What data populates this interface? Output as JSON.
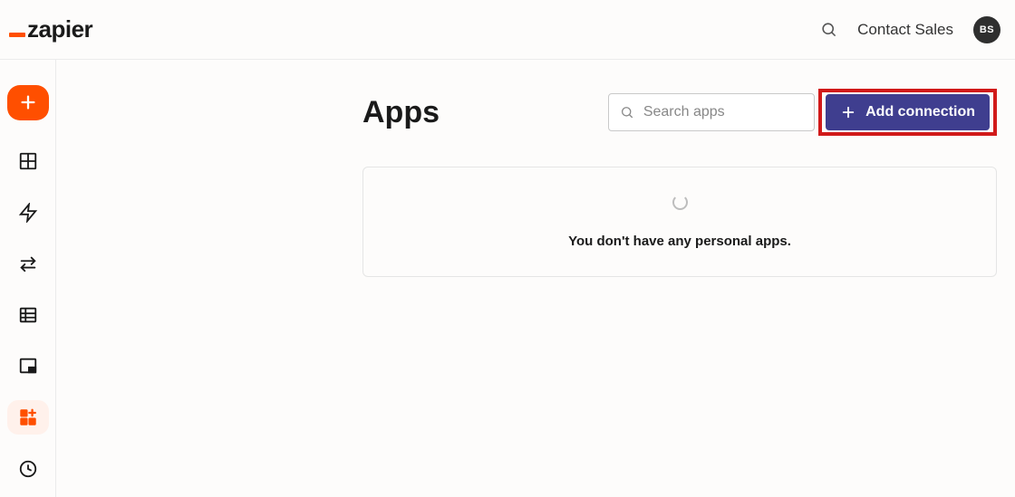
{
  "header": {
    "brand": "zapier",
    "contact_sales": "Contact Sales",
    "avatar_initials": "BS"
  },
  "page": {
    "title": "Apps",
    "search_placeholder": "Search apps",
    "add_connection_label": "Add connection",
    "empty_message": "You don't have any personal apps."
  }
}
